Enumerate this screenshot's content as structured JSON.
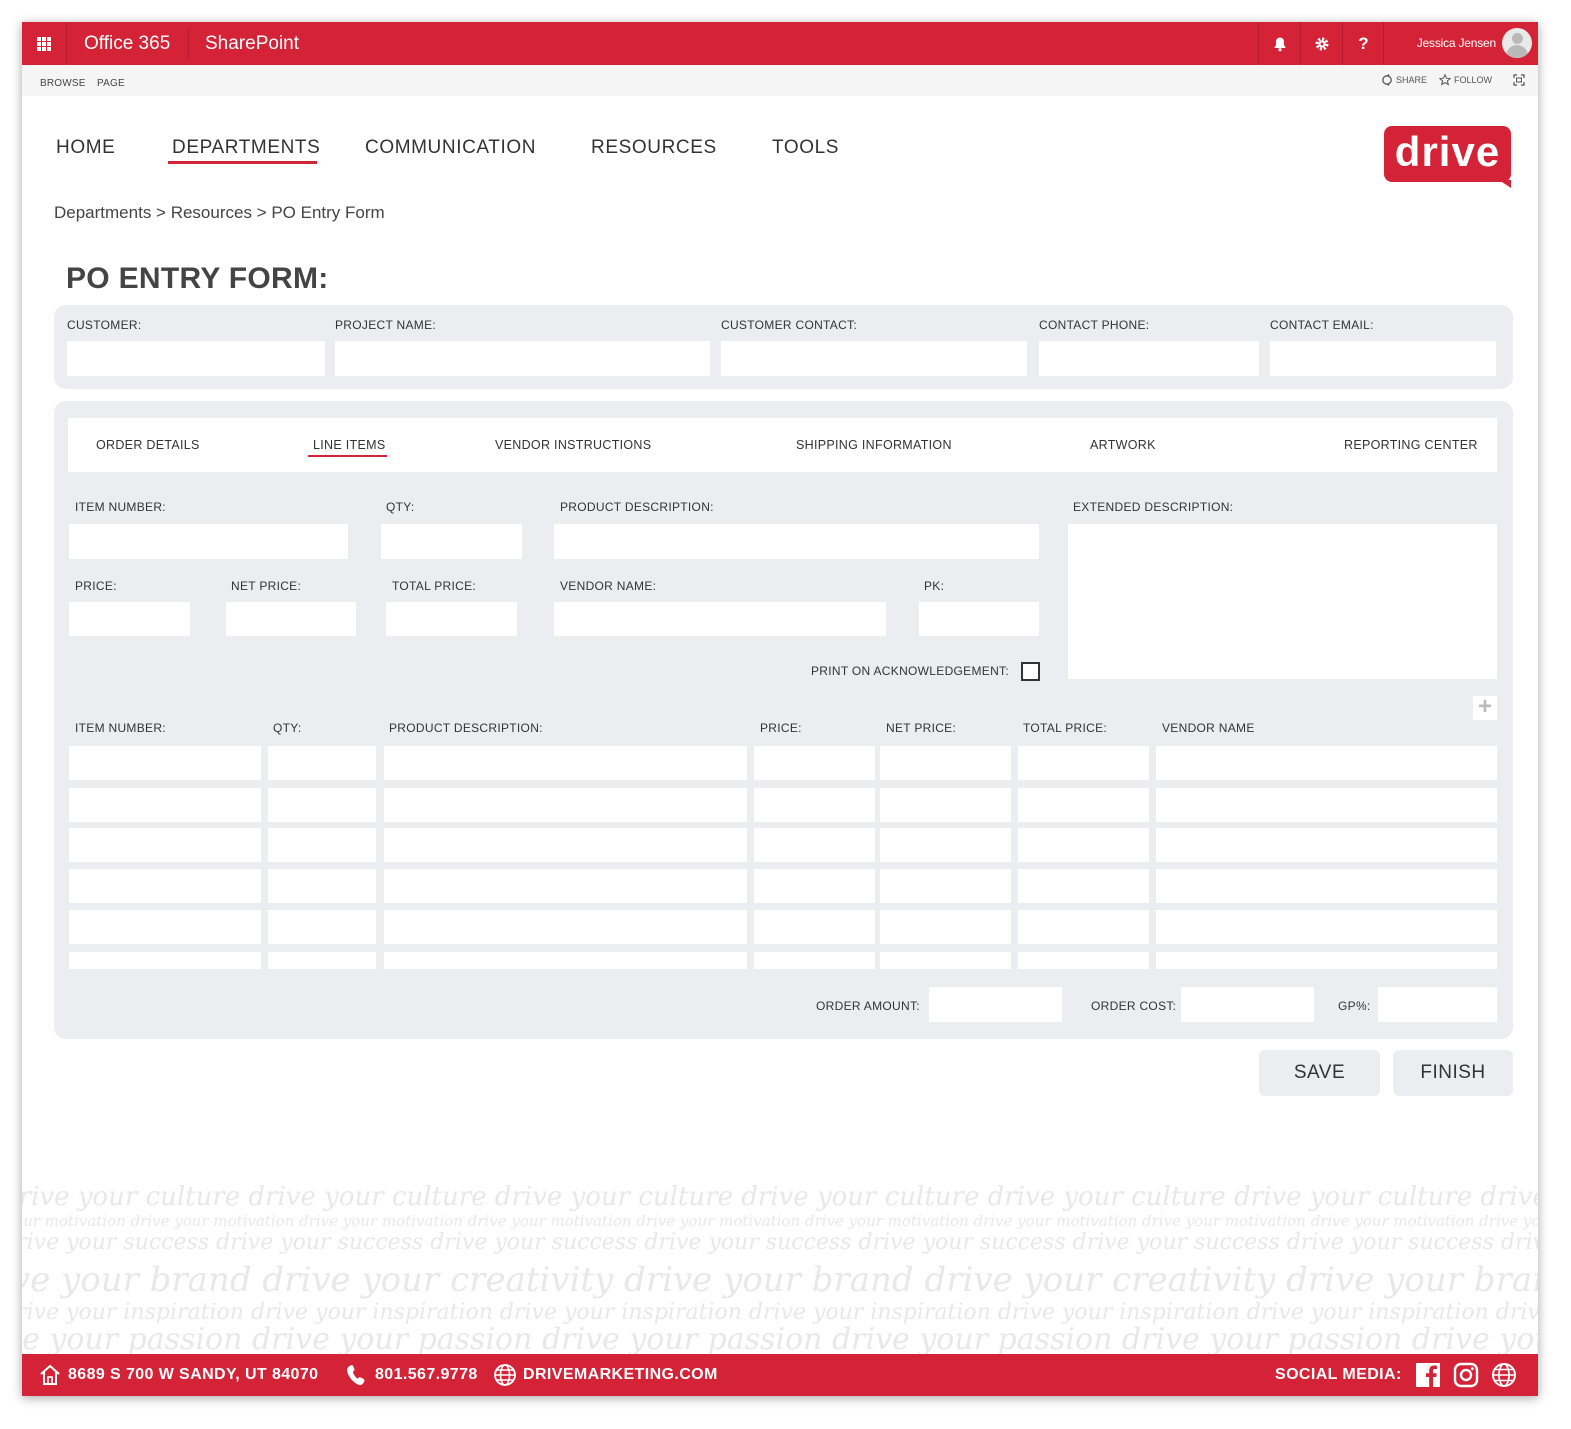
{
  "suite": {
    "app": "Office 365",
    "product": "SharePoint",
    "user": "Jessica Jensen",
    "help": "?"
  },
  "ribbon": {
    "tabs": [
      "BROWSE",
      "PAGE"
    ],
    "share": "SHARE",
    "follow": "FOLLOW"
  },
  "nav": {
    "items": [
      "HOME",
      "DEPARTMENTS",
      "COMMUNICATION",
      "RESOURCES",
      "TOOLS"
    ],
    "active": "DEPARTMENTS"
  },
  "logo": {
    "text": "drive"
  },
  "breadcrumb": "Departments > Resources > PO Entry Form",
  "page_title": "PO ENTRY FORM:",
  "customer_section": {
    "customer": "CUSTOMER:",
    "project_name": "PROJECT NAME:",
    "customer_contact": "CUSTOMER CONTACT:",
    "contact_phone": "CONTACT PHONE:",
    "contact_email": "CONTACT EMAIL:"
  },
  "tabs": {
    "items": [
      "ORDER DETAILS",
      "LINE ITEMS",
      "VENDOR INSTRUCTIONS",
      "SHIPPING INFORMATION",
      "ARTWORK",
      "REPORTING CENTER"
    ],
    "active": "LINE ITEMS"
  },
  "line_item_form": {
    "item_number": "ITEM NUMBER:",
    "qty": "QTY:",
    "product_description": "PRODUCT DESCRIPTION:",
    "extended_description": "EXTENDED DESCRIPTION:",
    "price": "PRICE:",
    "net_price": "NET PRICE:",
    "total_price": "TOTAL PRICE:",
    "vendor_name": "VENDOR NAME:",
    "pk": "PK:",
    "print_ack": "PRINT ON ACKNOWLEDGEMENT:",
    "print_ack_checked": false,
    "add_symbol": "+"
  },
  "table": {
    "headers": [
      "ITEM NUMBER:",
      "QTY:",
      "PRODUCT DESCRIPTION:",
      "PRICE:",
      "NET PRICE:",
      "TOTAL PRICE:",
      "VENDOR NAME"
    ],
    "rows": [
      [
        "",
        "",
        "",
        "",
        "",
        "",
        ""
      ],
      [
        "",
        "",
        "",
        "",
        "",
        "",
        ""
      ],
      [
        "",
        "",
        "",
        "",
        "",
        "",
        ""
      ],
      [
        "",
        "",
        "",
        "",
        "",
        "",
        ""
      ],
      [
        "",
        "",
        "",
        "",
        "",
        "",
        ""
      ],
      [
        "",
        "",
        "",
        "",
        "",
        "",
        ""
      ]
    ]
  },
  "totals": {
    "order_amount": "ORDER AMOUNT:",
    "order_cost": "ORDER COST:",
    "gp": "GP%:"
  },
  "buttons": {
    "save": "SAVE",
    "finish": "FINISH"
  },
  "watermark": {
    "phrases": [
      "drive your culture",
      "drive your motivation",
      "drive your success",
      "drive your brand",
      "drive your creativity",
      "drive your inspiration",
      "drive your passion"
    ]
  },
  "footer": {
    "address": "8689 S 700 W SANDY, UT 84070",
    "phone": "801.567.9778",
    "website": "DRIVEMARKETING.COM",
    "social_label": "SOCIAL MEDIA:"
  },
  "colors": {
    "brand": "#d42237",
    "panel": "#ecedf0"
  }
}
